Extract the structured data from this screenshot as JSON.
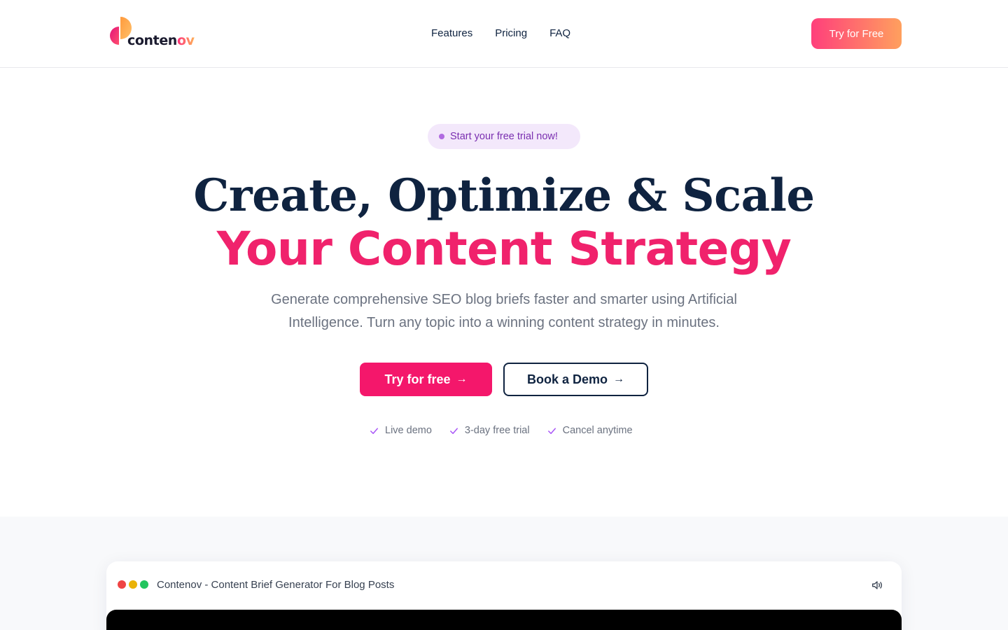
{
  "header": {
    "logo": {
      "text_main": "conten",
      "text_accent": "ov"
    },
    "nav": [
      {
        "label": "Features"
      },
      {
        "label": "Pricing"
      },
      {
        "label": "FAQ"
      }
    ],
    "cta_label": "Try for Free"
  },
  "hero": {
    "badge": "Start your free trial now!",
    "headline_line1": "Create, Optimize & Scale",
    "headline_line2": "Your Content Strategy",
    "subheadline": "Generate comprehensive SEO blog briefs faster and smarter using Artificial Intelligence. Turn any topic into a winning content strategy in minutes.",
    "primary_cta": "Try for free",
    "secondary_cta": "Book a Demo",
    "arrow": "→",
    "features": [
      {
        "label": "Live demo"
      },
      {
        "label": "3-day free trial"
      },
      {
        "label": "Cancel anytime"
      }
    ]
  },
  "demo": {
    "title": "Contenov - Content Brief Generator For Blog Posts",
    "window_dot_colors": [
      "#ef4444",
      "#eab308",
      "#22c55e"
    ],
    "icons": {
      "sound": "volume-icon"
    }
  },
  "colors": {
    "accent_pink": "#f4176b",
    "navy": "#0f2340",
    "badge_bg": "#f3e8fb",
    "badge_text": "#7a2fb0",
    "check": "#a855f7"
  }
}
